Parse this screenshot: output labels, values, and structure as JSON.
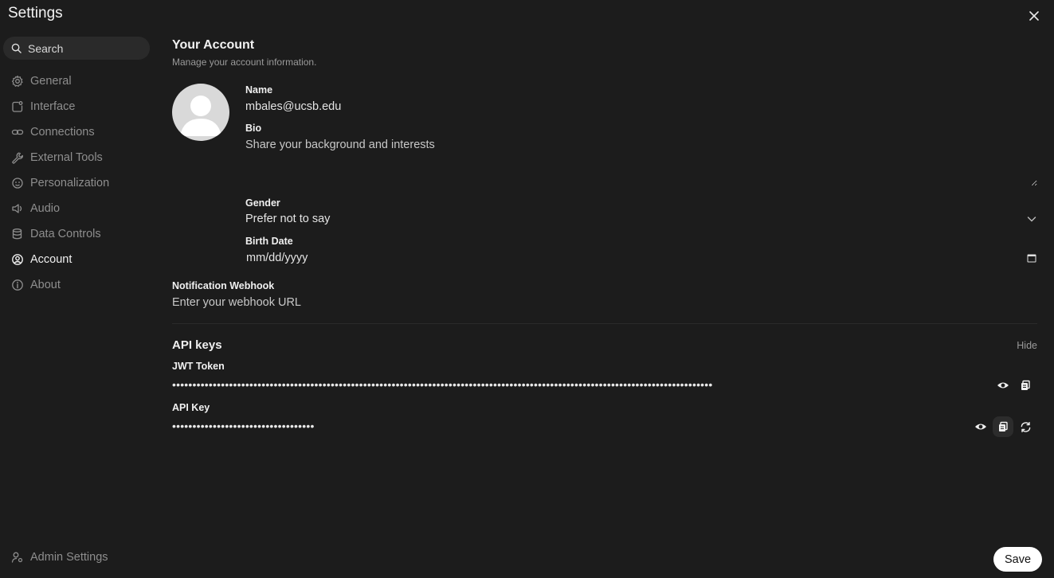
{
  "app": {
    "title": "Settings"
  },
  "search": {
    "placeholder": "Search"
  },
  "sidebar": {
    "items": [
      {
        "label": "General",
        "icon": "gear-icon"
      },
      {
        "label": "Interface",
        "icon": "interface-icon"
      },
      {
        "label": "Connections",
        "icon": "link-icon"
      },
      {
        "label": "External Tools",
        "icon": "wrench-icon"
      },
      {
        "label": "Personalization",
        "icon": "face-icon"
      },
      {
        "label": "Audio",
        "icon": "speaker-icon"
      },
      {
        "label": "Data Controls",
        "icon": "database-icon"
      },
      {
        "label": "Account",
        "icon": "user-circle-icon",
        "active": true
      },
      {
        "label": "About",
        "icon": "info-icon"
      }
    ],
    "admin_label": "Admin Settings"
  },
  "account": {
    "heading": "Your Account",
    "subheading": "Manage your account information.",
    "name_label": "Name",
    "name_value": "mbales@ucsb.edu",
    "bio_label": "Bio",
    "bio_placeholder": "Share your background and interests",
    "gender_label": "Gender",
    "gender_value": "Prefer not to say",
    "birth_label": "Birth Date",
    "birth_placeholder": "mm/dd/yyyy",
    "webhook_label": "Notification Webhook",
    "webhook_placeholder": "Enter your webhook URL"
  },
  "api": {
    "title": "API keys",
    "hide_label": "Hide",
    "jwt_label": "JWT Token",
    "jwt_masked": "•••••••••••••••••••••••••••••••••••••••••••••••••••••••••••••••••••••••••••••••••••••••••••••••••••••••••••••••••••••••••••••••••••••",
    "key_label": "API Key",
    "key_masked": "•••••••••••••••••••••••••••••••••••"
  },
  "actions": {
    "save_label": "Save"
  },
  "colors": {
    "background": "#1c1c1c",
    "accent": "#ffffff",
    "muted": "#8e8e8e"
  }
}
